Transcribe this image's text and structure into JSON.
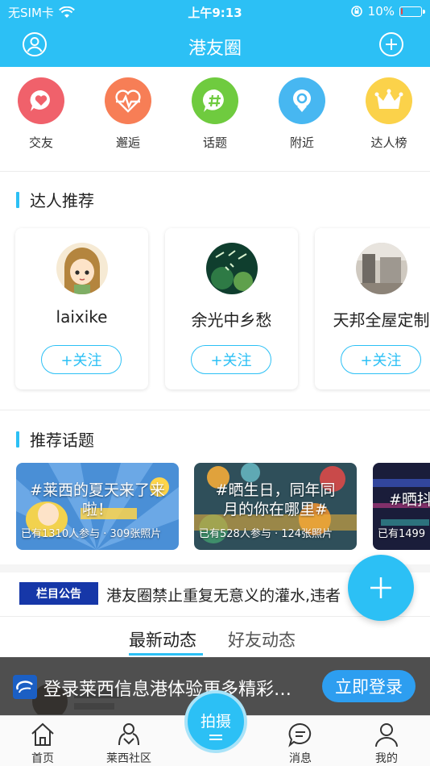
{
  "status_bar": {
    "carrier": "无SIM卡",
    "time": "上午9:13",
    "battery": "10%",
    "battery_level": 0.1
  },
  "header": {
    "title": "港友圈",
    "left_icon": "user-circle-icon",
    "right_icon": "plus-circle-icon"
  },
  "quick_actions": [
    {
      "label": "交友",
      "icon": "heart-chat-icon",
      "color": "#f0616b"
    },
    {
      "label": "邂逅",
      "icon": "heartbeat-icon",
      "color": "#f77e56"
    },
    {
      "label": "话题",
      "icon": "hashtag-icon",
      "color": "#6fcb3f"
    },
    {
      "label": "附近",
      "icon": "location-pin-icon",
      "color": "#47b7f1"
    },
    {
      "label": "达人榜",
      "icon": "crown-icon",
      "color": "#fbd24a"
    }
  ],
  "experts": {
    "title": "达人推荐",
    "items": [
      {
        "name": "laixike",
        "follow_label": "+关注"
      },
      {
        "name": "余光中乡愁",
        "follow_label": "+关注"
      },
      {
        "name": "天邦全屋定制",
        "follow_label": "+关注"
      }
    ]
  },
  "topics": {
    "title": "推荐话题",
    "items": [
      {
        "title": "#莱西的夏天来了来啦！",
        "meta": "已有1310人参与 · 309张照片"
      },
      {
        "title": "#晒生日，同年同月的你在哪里#",
        "meta": "已有528人参与 · 124张照片"
      },
      {
        "title": "#晒抖",
        "meta": "已有1499"
      }
    ]
  },
  "notice": {
    "tag": "栏目公告",
    "text": "港友圈禁止重复无意义的灌水,违者"
  },
  "feed_tabs": [
    {
      "label": "最新动态",
      "active": true
    },
    {
      "label": "好友动态",
      "active": false
    }
  ],
  "login_banner": {
    "message": "登录莱西信息港体验更多精彩…",
    "button": "立即登录"
  },
  "bottom_nav": [
    {
      "label": "首页",
      "icon": "home-icon"
    },
    {
      "label": "莱西社区",
      "icon": "community-icon"
    },
    {
      "label": "拍摄",
      "icon": "shoot-icon"
    },
    {
      "label": "消息",
      "icon": "message-icon"
    },
    {
      "label": "我的",
      "icon": "profile-icon"
    }
  ]
}
